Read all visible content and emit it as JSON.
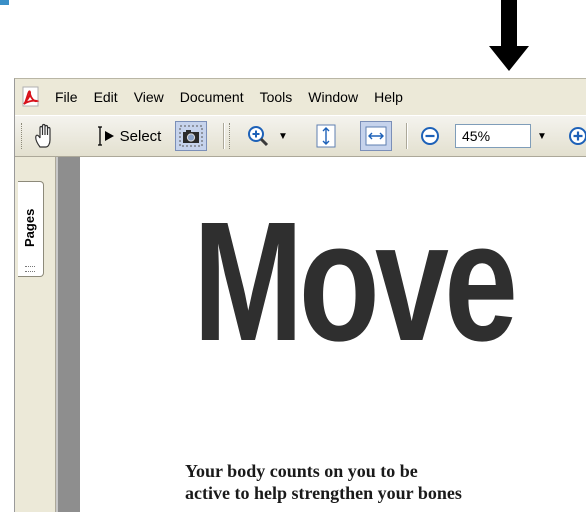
{
  "menubar": {
    "items": [
      "File",
      "Edit",
      "View",
      "Document",
      "Tools",
      "Window",
      "Help"
    ]
  },
  "toolbar": {
    "hand_tool": "hand-tool-icon",
    "select_label": "Select",
    "snapshot_tool": "camera-icon",
    "zoom_value": "45%"
  },
  "navigation": {
    "pages_tab_label": "Pages"
  },
  "document": {
    "title": "Move",
    "subtitle_line1": "Your body counts on you to be",
    "subtitle_line2": "active to help strengthen your bones"
  },
  "colors": {
    "accent_mark": "#3a8fc7",
    "arrow": "#000000",
    "chrome": "#ece9d8",
    "gutter": "#8e8e8e",
    "title_text": "#2f2f2f"
  }
}
